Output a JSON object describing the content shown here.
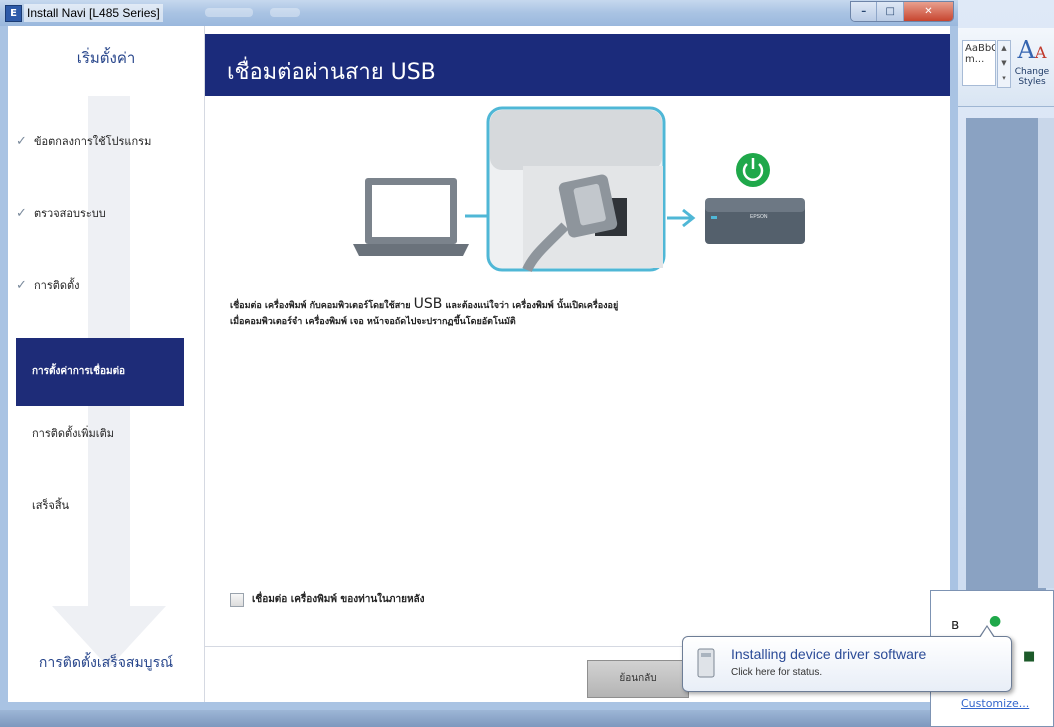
{
  "window": {
    "title": "Install Navi [L485 Series]",
    "icon_letter": "E"
  },
  "sidebar": {
    "title": "เริ่มตั้งค่า",
    "items": [
      {
        "label": "ข้อตกลงการใช้โปรแกรม",
        "done": true
      },
      {
        "label": "ตรวจสอบระบบ",
        "done": true
      },
      {
        "label": "การติดตั้ง",
        "done": true
      },
      {
        "label": "การตั้งค่าการเชื่อมต่อ",
        "active": true
      },
      {
        "label": "การติดตั้งเพิ่มเติม"
      },
      {
        "label": "เสร็จสิ้น"
      }
    ],
    "finish": "การติดตั้งเสร็จสมบูรณ์",
    "check_glyph": "✓"
  },
  "main": {
    "title": "เชื่อมต่อผ่านสาย USB",
    "instruction_part1": "เชื่อมต่อ เครื่องพิมพ์ กับคอมพิวเตอร์โดยใช้สาย",
    "instruction_usb": "USB",
    "instruction_part2": "และต้องแน่ใจว่า เครื่องพิมพ์ นั้นเปิดเครื่องอยู่",
    "instruction_line2": "เมื่อคอมพิวเตอร์จำ เครื่องพิมพ์ เจอ หน้าจอถัดไปจะปรากฏขึ้นโดยอัตโนมัติ",
    "printer_brand": "EPSON",
    "background_checkbox_label": "เชื่อมต่อ เครื่องพิมพ์ ของท่านในภายหลัง",
    "back_button": "ย้อนกลับ"
  },
  "word": {
    "style_preview": "AaBbCcDd",
    "style_name": "m...",
    "change_styles_line1": "Change",
    "change_styles_line2": "Styles"
  },
  "tray": {
    "customize": "Customize..."
  },
  "balloon": {
    "title": "Installing device driver software",
    "subtitle": "Click here for status."
  },
  "colors": {
    "header_bg": "#1b2b7b",
    "active_item_bg": "#1e2c78",
    "accent_teal": "#4fb7d6",
    "power_green": "#1fa84a"
  }
}
